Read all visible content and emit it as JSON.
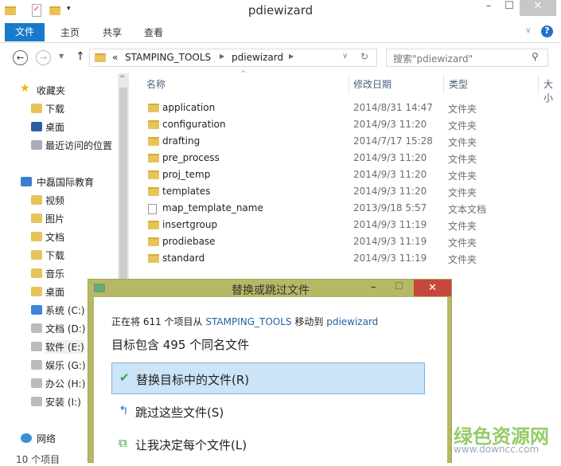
{
  "window": {
    "title": "pdiewizard",
    "minimize": "–",
    "maximize": "☐",
    "close": "✕"
  },
  "ribbon": {
    "tabs": [
      "文件",
      "主页",
      "共享",
      "查看"
    ],
    "help": "?"
  },
  "address": {
    "prefix": "«",
    "crumbs": [
      "STAMPING_TOOLS",
      "pdiewizard"
    ],
    "search_placeholder": "搜索\"pdiewizard\""
  },
  "nav": {
    "favorites": "收藏夹",
    "fav_items": [
      "下载",
      "桌面",
      "最近访问的位置"
    ],
    "computer": "中磊国际教育",
    "computer_items": [
      "视频",
      "图片",
      "文档",
      "下载",
      "音乐",
      "桌面",
      "系统 (C:)",
      "文档 (D:)",
      "软件 (E:)",
      "娱乐 (G:)",
      "办公 (H:)",
      "安装 (I:)"
    ],
    "network": "网络",
    "status": "10 个项目"
  },
  "columns": {
    "name": "名称",
    "date": "修改日期",
    "type": "类型",
    "size": "大小"
  },
  "files": [
    {
      "name": "application",
      "date": "2014/8/31 14:47",
      "type": "文件夹"
    },
    {
      "name": "configuration",
      "date": "2014/9/3 11:20",
      "type": "文件夹"
    },
    {
      "name": "drafting",
      "date": "2014/7/17 15:28",
      "type": "文件夹"
    },
    {
      "name": "pre_process",
      "date": "2014/9/3 11:20",
      "type": "文件夹"
    },
    {
      "name": "proj_temp",
      "date": "2014/9/3 11:20",
      "type": "文件夹"
    },
    {
      "name": "templates",
      "date": "2014/9/3 11:20",
      "type": "文件夹"
    },
    {
      "name": "map_template_name",
      "date": "2013/9/18 5:57",
      "type": "文本文档"
    },
    {
      "name": "insertgroup",
      "date": "2014/9/3 11:19",
      "type": "文件夹"
    },
    {
      "name": "prodiebase",
      "date": "2014/9/3 11:19",
      "type": "文件夹"
    },
    {
      "name": "standard",
      "date": "2014/9/3 11:19",
      "type": "文件夹"
    }
  ],
  "dialog": {
    "title": "替换或跳过文件",
    "line_a": "正在将 611 个项目从",
    "src": "STAMPING_TOOLS",
    "line_b": "移动到",
    "dst": "pdiewizard",
    "heading": "目标包含 495 个同名文件",
    "options": [
      "替换目标中的文件(R)",
      "跳过这些文件(S)",
      "让我决定每个文件(L)"
    ]
  },
  "watermark": {
    "text": "绿色资源网",
    "url": "www.downcc.com"
  }
}
